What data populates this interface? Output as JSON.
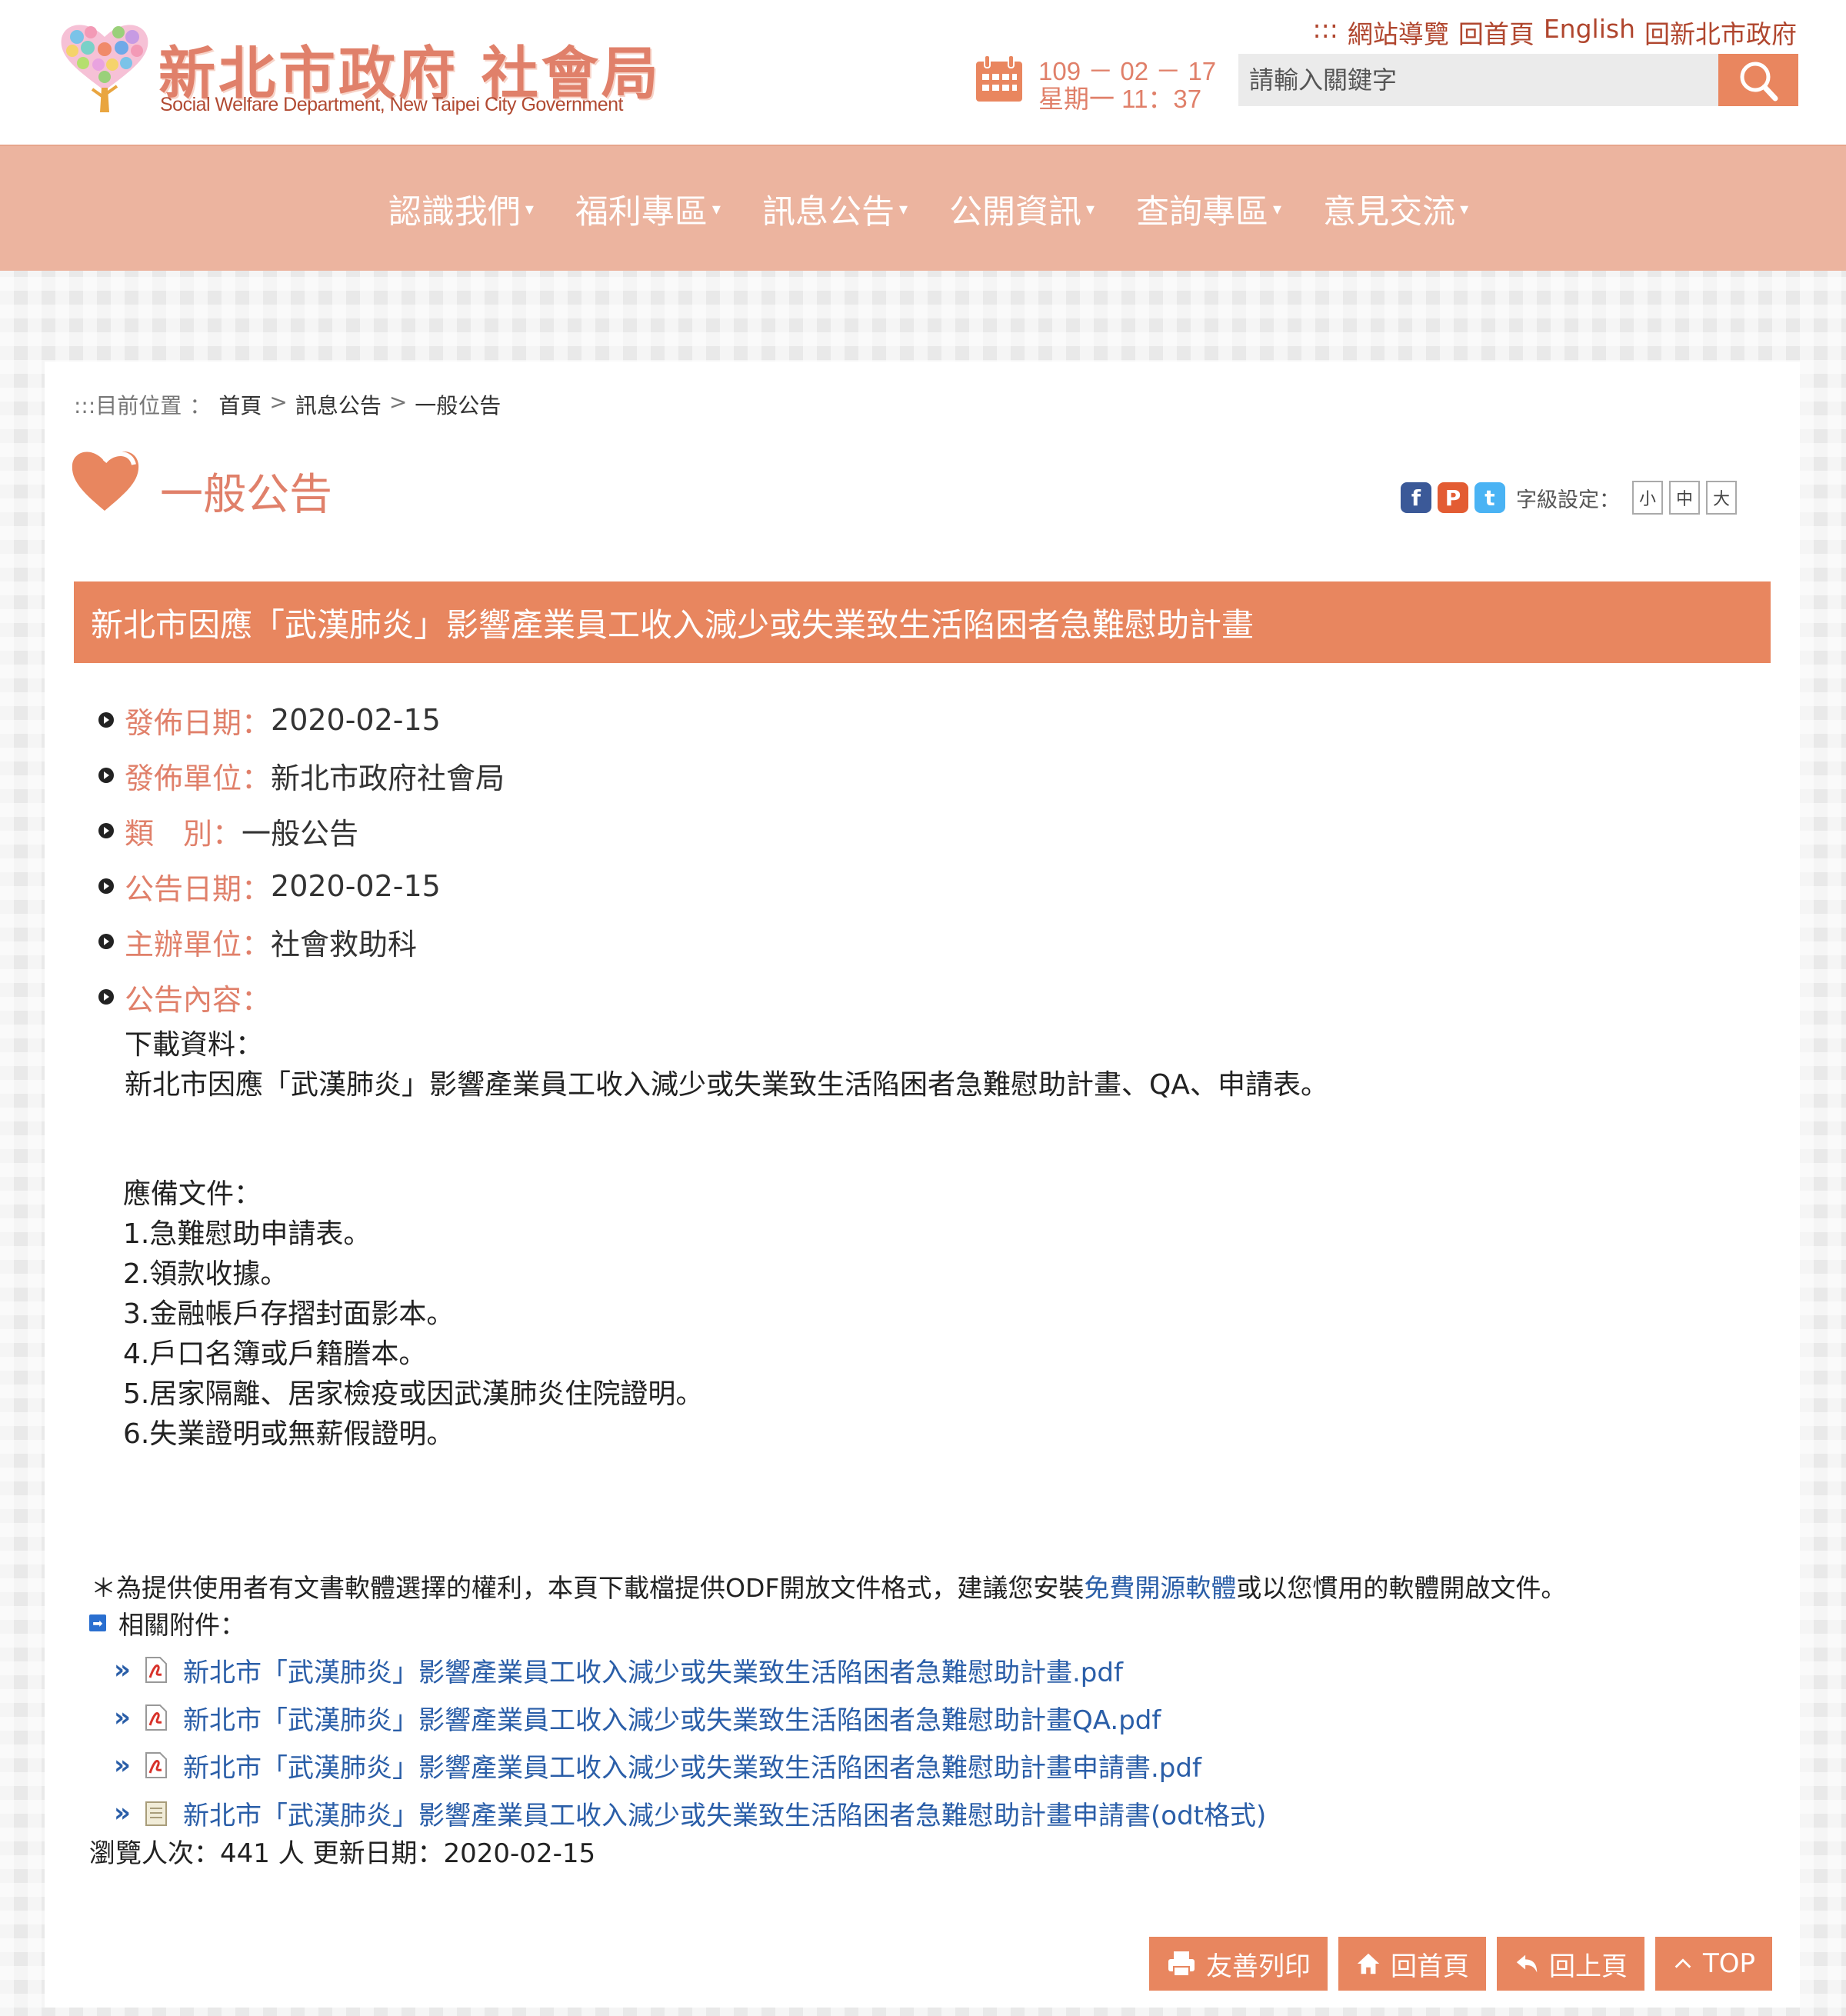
{
  "header": {
    "logo_title": "新北市政府 社會局",
    "logo_subtitle": "Social Welfare Department, New Taipei City Government",
    "top_links": {
      "prefix": ":::",
      "sitemap": "網站導覽",
      "home": "回首頁",
      "english": "English",
      "city": "回新北市政府"
    },
    "date_line1": "109 － 02 － 17",
    "date_line2": "星期一 11：37",
    "search_placeholder": "請輸入關鍵字"
  },
  "nav": {
    "items": [
      {
        "label": "認識我們"
      },
      {
        "label": "福利專區"
      },
      {
        "label": "訊息公告"
      },
      {
        "label": "公開資訊"
      },
      {
        "label": "查詢專區"
      },
      {
        "label": "意見交流"
      }
    ],
    "caret": "▾"
  },
  "breadcrumb": {
    "label": ":::目前位置",
    "colon": "：",
    "home": "首頁",
    "sep": ">",
    "section": "訊息公告",
    "current": "一般公告"
  },
  "page_title": "一般公告",
  "tools": {
    "font_size_label": "字級設定：",
    "small": "小",
    "medium": "中",
    "large": "大"
  },
  "article": {
    "title": "新北市因應「武漢肺炎」影響產業員工收入減少或失業致生活陷困者急難慰助計畫",
    "meta": [
      {
        "label": "發佈日期：",
        "value": "2020-02-15"
      },
      {
        "label": "發佈單位：",
        "value": "新北市政府社會局"
      },
      {
        "label": "類　別：",
        "value": "一般公告"
      },
      {
        "label": "公告日期：",
        "value": "2020-02-15"
      },
      {
        "label": "主辦單位：",
        "value": "社會救助科"
      },
      {
        "label": "公告內容：",
        "value": ""
      }
    ],
    "download_head": "下載資料：",
    "download_text": "新北市因應「武漢肺炎」影響產業員工收入減少或失業致生活陷困者急難慰助計畫、QA、申請表。",
    "docs_head": "應備文件：",
    "docs": [
      "1.急難慰助申請表。",
      "2.領款收據。",
      "3.金融帳戶存摺封面影本。",
      "4.戶口名簿或戶籍謄本。",
      "5.居家隔離、居家檢疫或因武漢肺炎住院證明。",
      "6.失業證明或無薪假證明。"
    ]
  },
  "odf_note": {
    "before": "＊為提供使用者有文書軟體選擇的權利，本頁下載檔提供ODF開放文件格式，建議您安裝",
    "link": "免費開源軟體",
    "after": "或以您慣用的軟體開啟文件。"
  },
  "attachments": {
    "head": "相關附件：",
    "items": [
      {
        "name": "新北市「武漢肺炎」影響產業員工收入減少或失業致生活陷困者急難慰助計畫.pdf",
        "type": "pdf"
      },
      {
        "name": "新北市「武漢肺炎」影響產業員工收入減少或失業致生活陷困者急難慰助計畫QA.pdf",
        "type": "pdf"
      },
      {
        "name": "新北市「武漢肺炎」影響產業員工收入減少或失業致生活陷困者急難慰助計畫申請書.pdf",
        "type": "pdf"
      },
      {
        "name": "新北市「武漢肺炎」影響產業員工收入減少或失業致生活陷困者急難慰助計畫申請書(odt格式)",
        "type": "odt"
      }
    ]
  },
  "footer_info": {
    "views_label": "瀏覽人次：",
    "views_value": "441 人",
    "updated_label": "更新日期：",
    "updated_value": "2020-02-15"
  },
  "buttons": {
    "print": "友善列印",
    "home": "回首頁",
    "back": "回上頁",
    "top": "TOP"
  },
  "colors": {
    "accent": "#e8865f",
    "nav_bg": "#ecb49f",
    "title_text": "#e0806a",
    "link": "#2a5ea8"
  }
}
